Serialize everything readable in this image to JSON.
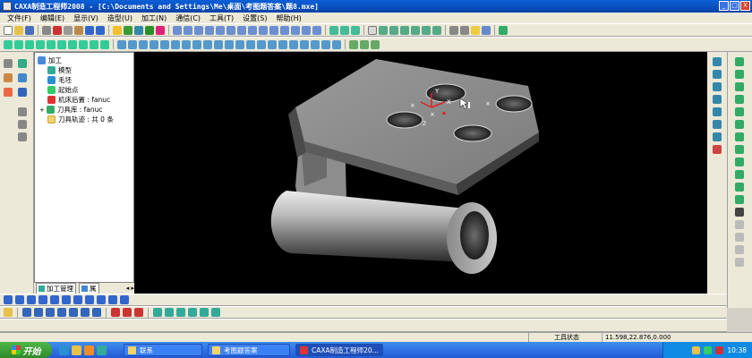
{
  "window": {
    "title": "CAXA制造工程师2008  - [C:\\Documents and Settings\\Me\\桌面\\考图题答案\\题8.mxe]",
    "buttons": [
      "_",
      "□",
      "X"
    ]
  },
  "menu": [
    "文件(F)",
    "编辑(E)",
    "显示(V)",
    "造型(U)",
    "加工(N)",
    "通信(C)",
    "工具(T)",
    "设置(S)",
    "帮助(H)"
  ],
  "tree": {
    "root": "加工",
    "items": [
      {
        "icon": "model-icon",
        "label": "模型"
      },
      {
        "icon": "blank-icon",
        "label": "毛坯"
      },
      {
        "icon": "start-point-icon",
        "label": "起始点"
      },
      {
        "icon": "machine-post-icon",
        "label": "机床后置 : fanuc"
      },
      {
        "icon": "tool-library-icon",
        "label": "刀具库 : fanuc"
      },
      {
        "icon": "toolpath-folder-icon",
        "label": "刀具轨迹 : 共 0 条"
      }
    ],
    "tabs": [
      "加工管理",
      "属"
    ]
  },
  "viewport": {
    "axis_labels": {
      "x": "X",
      "y": "Y",
      "z": "Z"
    }
  },
  "status": {
    "state": "工具状态",
    "coords": "11.598,22.876,0.000"
  },
  "taskbar": {
    "start_label": "开始",
    "items": [
      "联系",
      "考图题答案",
      "CAXA制造工程师20..."
    ],
    "clock": "10:38"
  },
  "colors": {
    "titlebar": "#0a5fd8",
    "viewport_bg": "#000000",
    "taskbar": "#2459d6",
    "start": "#3a9a34"
  }
}
